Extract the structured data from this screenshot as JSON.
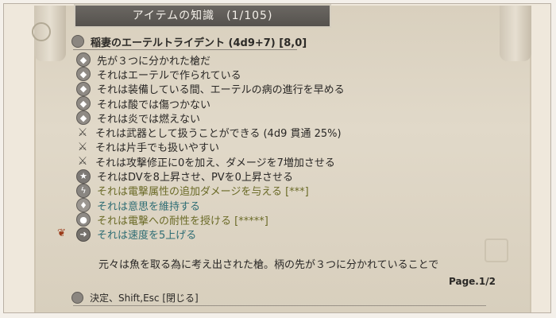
{
  "window": {
    "title": "アイテムの知識　(1/105)"
  },
  "item": {
    "name": "稲妻のエーテルトライデント (4d9+7) [8,0]"
  },
  "properties": [
    {
      "icon": "diamond-icon",
      "text": "先が３つに分かれた槍だ",
      "tone": "dark"
    },
    {
      "icon": "diamond-icon",
      "text": "それはエーテルで作られている",
      "tone": "dark"
    },
    {
      "icon": "diamond-icon",
      "text": "それは装備している間、エーテルの病の進行を早める",
      "tone": "dark"
    },
    {
      "icon": "diamond-icon",
      "text": "それは酸では傷つかない",
      "tone": "dark"
    },
    {
      "icon": "diamond-icon",
      "text": "それは炎では燃えない",
      "tone": "dark"
    },
    {
      "icon": "sword-icon",
      "text": "それは武器として扱うことができる (4d9 貫通 25%)",
      "tone": "dark"
    },
    {
      "icon": "sword-icon",
      "text": "それは片手でも扱いやすい",
      "tone": "dark"
    },
    {
      "icon": "sword-icon",
      "text": "それは攻撃修正に0を加え、ダメージを7増加させる",
      "tone": "dark"
    },
    {
      "icon": "star-icon",
      "text": "それはDVを8上昇させ、PVを0上昇させる",
      "tone": "dark"
    },
    {
      "icon": "lightning-icon",
      "text": "それは電撃属性の追加ダメージを与える [***]",
      "tone": "olive"
    },
    {
      "icon": "will-icon",
      "text": "それは意思を維持する",
      "tone": "teal"
    },
    {
      "icon": "resist-icon",
      "text": "それは電撃への耐性を授ける [*****]",
      "tone": "olive"
    },
    {
      "icon": "speed-icon",
      "text": "それは速度を5上げる",
      "tone": "teal"
    }
  ],
  "description": "元々は魚を取る為に考え出された槍。柄の先が３つに分かれていることで",
  "pagination": {
    "label": "Page.1/2"
  },
  "footer": {
    "hint": "決定、Shift,Esc [閉じる]"
  }
}
